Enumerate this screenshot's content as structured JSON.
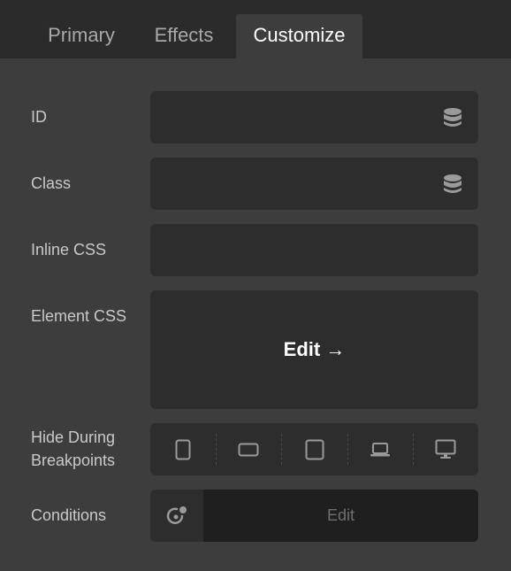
{
  "tabs": [
    {
      "label": "Primary",
      "active": false
    },
    {
      "label": "Effects",
      "active": false
    },
    {
      "label": "Customize",
      "active": true
    }
  ],
  "fields": {
    "id": {
      "label": "ID",
      "value": "",
      "icon": "database-icon"
    },
    "class": {
      "label": "Class",
      "value": "",
      "icon": "database-icon"
    },
    "inline_css": {
      "label": "Inline CSS",
      "value": ""
    },
    "element_css": {
      "label": "Element CSS",
      "edit_label": "Edit →"
    },
    "hide_breakpoints": {
      "label_line1": "Hide During",
      "label_line2": "Breakpoints",
      "devices": [
        "phone-portrait-icon",
        "phone-landscape-icon",
        "tablet-icon",
        "laptop-icon",
        "desktop-icon"
      ]
    },
    "conditions": {
      "label": "Conditions",
      "edit_label": "Edit",
      "icon": "conditions-icon"
    }
  },
  "colors": {
    "background": "#3d3d3d",
    "tabbar": "#2b2b2b",
    "field": "#2d2d2d",
    "conditions_edit": "#1f1f1f"
  }
}
